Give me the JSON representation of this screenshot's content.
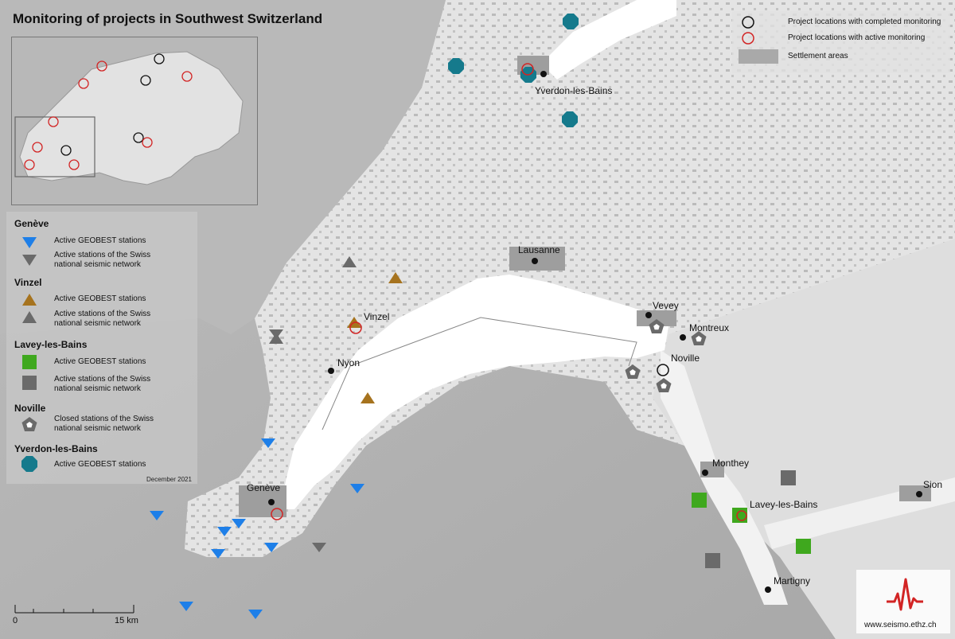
{
  "map": {
    "title": "Monitoring of projects in Southwest Switzerland",
    "date": "December 2021",
    "website": "www.seismo.ethz.ch",
    "scale": {
      "zero": "0",
      "end": "15 km"
    },
    "top_legend": {
      "completed": "Project locations with completed monitoring",
      "active": "Project locations with active monitoring",
      "settlement": "Settlement areas"
    },
    "legend": {
      "geneve": {
        "title": "Genève",
        "geobest": "Active GEOBEST stations",
        "swiss_1": "Active stations of the Swiss",
        "swiss_2": "national seismic network"
      },
      "vinzel": {
        "title": "Vinzel",
        "geobest": "Active GEOBEST stations",
        "swiss_1": "Active stations of the Swiss",
        "swiss_2": "national seismic network"
      },
      "lavey": {
        "title": "Lavey-les-Bains",
        "geobest": "Active GEOBEST stations",
        "swiss_1": "Active stations of the Swiss",
        "swiss_2": "national seismic network"
      },
      "noville": {
        "title": "Noville",
        "closed_1": "Closed stations of the Swiss",
        "closed_2": "national seismic network"
      },
      "yverdon": {
        "title": "Yverdon-les-Bains",
        "geobest": "Active GEOBEST stations"
      }
    },
    "cities": {
      "yverdon": "Yverdon-les-Bains",
      "lausanne": "Lausanne",
      "vevey": "Vevey",
      "montreux": "Montreux",
      "noville": "Noville",
      "vinzel": "Vinzel",
      "nyon": "Nyon",
      "geneve": "Genève",
      "monthey": "Monthey",
      "lavey": "Lavey-les-Bains",
      "sion": "Sion",
      "martigny": "Martigny"
    },
    "colors": {
      "geneve_geobest": "#1e7fe8",
      "vinzel_geobest": "#a6731e",
      "lavey_geobest": "#3fa81e",
      "yverdon_geobest": "#157a8c",
      "swiss_network": "#6a6a6a",
      "active_ring": "#d22424",
      "completed_ring": "#111111",
      "lake": "#ffffff",
      "settlement": "#a9a9a9",
      "terrain": "#c9c9c9",
      "lowland": "#e6e6e6"
    },
    "icons": {
      "geneve_symbol": "triangle-down",
      "vinzel_symbol": "triangle-up",
      "lavey_symbol": "square",
      "noville_symbol": "pentagon",
      "yverdon_symbol": "octagon",
      "logo_symbol": "seismogram-logo"
    }
  }
}
